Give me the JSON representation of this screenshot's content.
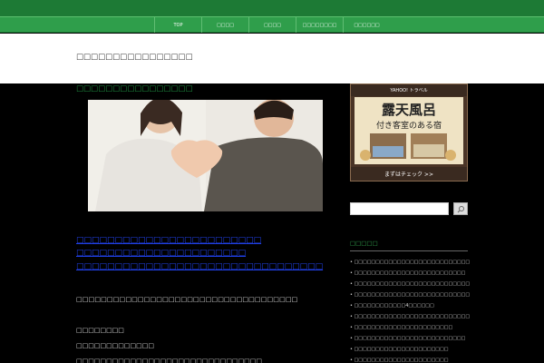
{
  "nav": {
    "items": [
      "TOP",
      "□□□□",
      "□□□□",
      "□□□□□□□□",
      "□□□□□□"
    ]
  },
  "site": {
    "title": "□□□□□□□□□□□□□□□□"
  },
  "main": {
    "title": "□□□□□□□□□□□□□□□□",
    "links": [
      "□□□□□□□□□□□□□□□□□□□□□□□□",
      "□□□□□□□□□□□□□□□□□□□□□□",
      "□□□□□□□□□□□□□□□□□□□□□□□□□□□□□□□□"
    ],
    "text": "□□□□□□□□□□□□□□□□□□□□□□□□□□□□□□□□□□□□",
    "list": [
      "□□□□□□□□",
      "□□□□□□□□□□□□□",
      "□□□□□□□□□□□□□□□□□□□□□□□□□□□□□□□"
    ]
  },
  "ad": {
    "top": "YAHOO! トラベル",
    "big": "露天風呂",
    "sub": "付き客室のある宿",
    "button": "まずはチェック >>"
  },
  "search": {
    "placeholder": ""
  },
  "sidebar": {
    "title": "□□□□□",
    "items": [
      "• □□□□□□□□□□□□□□□□□□□□□□□□□□□□□□□",
      "• □□□□□□□□□□□□□□□□□□□□□□□□□□",
      "• □□□□□□□□□□□□□□□□□□□□□□□□□□□□□□",
      "• □□□□□□□□□□□□□□□□□□□□□□□□□□□□□□□□",
      "• □□□□□□□□□□□□4□□□□□□",
      "• □□□□□□□□□□□□□□□□□□□□□□□□□□□□□□□□□□□□□□",
      "• □□□□□□□□□□□□□□□□□□□□□□□",
      "• □□□□□□□□□□□□□□□□□□□□□□□□□□",
      "• □□□□□□□□□□□□□□□□□□□□□□",
      "• □□□□□□□□□□□□□□□□□□□□□□"
    ]
  },
  "colors": {
    "nav_green": "#2f9e4b",
    "top_green": "#1d7a35",
    "link_blue": "#2040e6"
  }
}
